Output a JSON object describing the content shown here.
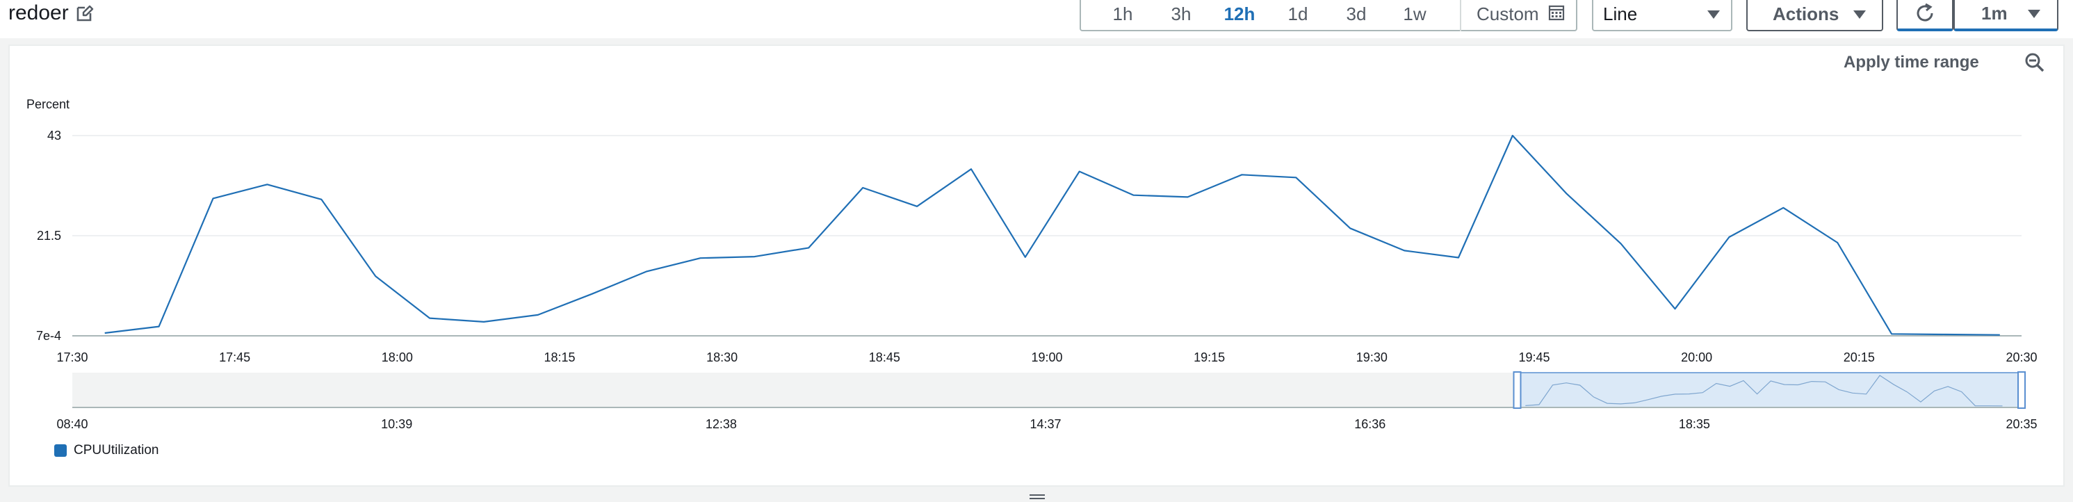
{
  "widget": {
    "title": "redoer"
  },
  "toolbar": {
    "ranges": [
      "1h",
      "3h",
      "12h",
      "1d",
      "3d",
      "1w"
    ],
    "active_range": "12h",
    "custom_label": "Custom",
    "chart_type": "Line",
    "actions_label": "Actions",
    "interval_label": "1m"
  },
  "apply_time_range_label": "Apply time range",
  "colors": {
    "series": "#1f6fb5",
    "accent": "#1f6fb5"
  },
  "chart_data": {
    "type": "line",
    "ylabel": "Percent",
    "y_ticks": [
      "43",
      "21.5",
      "7e-4"
    ],
    "ylim": [
      0.0007,
      43
    ],
    "x_ticks": [
      "17:30",
      "17:45",
      "18:00",
      "18:15",
      "18:30",
      "18:45",
      "19:00",
      "19:15",
      "19:30",
      "19:45",
      "20:00",
      "20:15",
      "20:30"
    ],
    "xlim": [
      "17:30",
      "20:30"
    ],
    "series": [
      {
        "name": "CPUUtilization",
        "x": [
          "17:33",
          "17:38",
          "17:43",
          "17:48",
          "17:53",
          "17:58",
          "18:03",
          "18:08",
          "18:13",
          "18:18",
          "18:23",
          "18:28",
          "18:33",
          "18:38",
          "18:43",
          "18:48",
          "18:53",
          "18:58",
          "19:03",
          "19:08",
          "19:13",
          "19:18",
          "19:23",
          "19:28",
          "19:33",
          "19:38",
          "19:43",
          "19:48",
          "19:53",
          "19:58",
          "20:03",
          "20:08",
          "20:13",
          "20:18",
          "20:23",
          "20:28"
        ],
        "values": [
          0.6,
          2.0,
          29.5,
          32.5,
          29.3,
          12.8,
          3.8,
          3.0,
          4.5,
          9.0,
          13.8,
          16.7,
          17.0,
          18.9,
          31.8,
          27.8,
          35.8,
          16.9,
          35.3,
          30.2,
          29.8,
          34.6,
          34.0,
          23.1,
          18.3,
          16.8,
          43.0,
          30.5,
          19.8,
          5.8,
          21.2,
          27.5,
          20.0,
          0.4,
          0.3,
          0.2
        ]
      }
    ],
    "navigator": {
      "x_ticks": [
        "08:40",
        "10:39",
        "12:38",
        "14:37",
        "16:36",
        "18:35",
        "20:35"
      ],
      "selected_range": [
        "17:30",
        "20:35"
      ]
    },
    "legend": [
      "CPUUtilization"
    ],
    "grid": true
  }
}
